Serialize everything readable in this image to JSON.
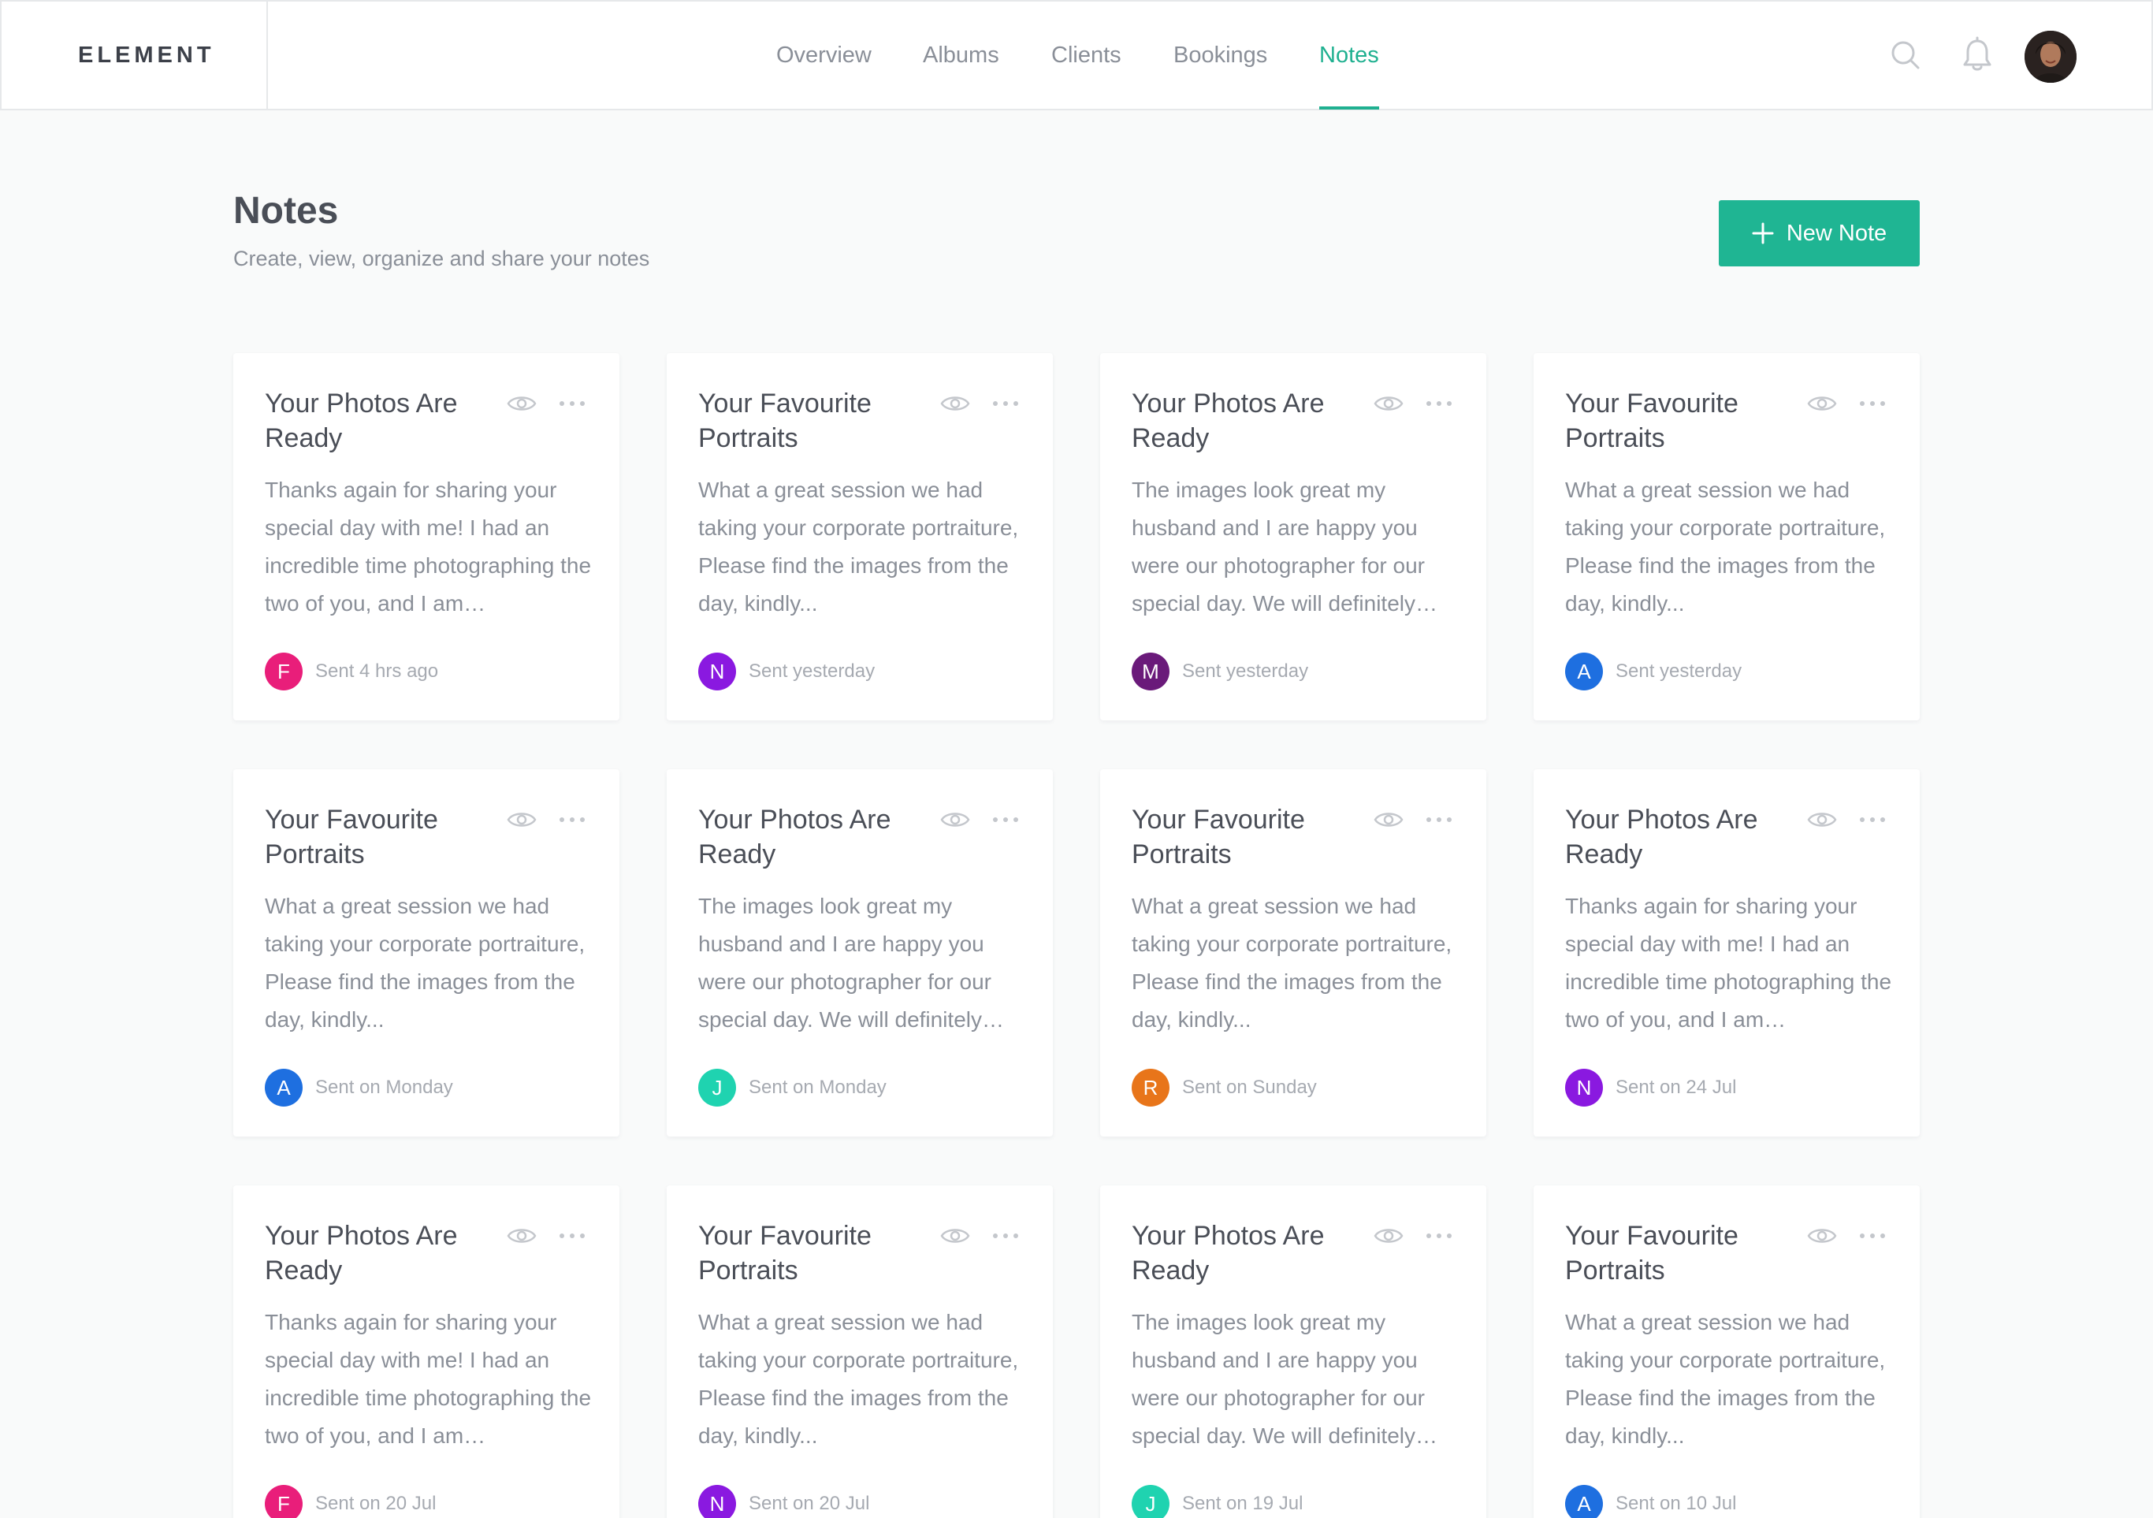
{
  "app": {
    "logo": "ELEMENT"
  },
  "nav": {
    "items": [
      {
        "label": "Overview",
        "active": false
      },
      {
        "label": "Albums",
        "active": false
      },
      {
        "label": "Clients",
        "active": false
      },
      {
        "label": "Bookings",
        "active": false
      },
      {
        "label": "Notes",
        "active": true
      }
    ]
  },
  "header_icons": [
    "search-icon",
    "bell-icon",
    "user-avatar"
  ],
  "page": {
    "title": "Notes",
    "subtitle": "Create, view, organize and share your notes",
    "new_note_label": "New Note"
  },
  "colors": {
    "accent": "#1fb593",
    "nav_active": "#1fb090"
  },
  "notes": [
    {
      "title": "Your Photos Are Ready",
      "body": "Thanks again for sharing your special day with me! I had an incredible time photographing the two of you, and I am…",
      "initial": "F",
      "color": "#e91e7a",
      "sent": "Sent 4 hrs ago"
    },
    {
      "title": "Your Favourite Portraits",
      "body": "What  a great session we had taking your corporate portraiture, Please find the images from the day, kindly...",
      "initial": "N",
      "color": "#8a19e0",
      "sent": "Sent yesterday"
    },
    {
      "title": "Your Photos Are Ready",
      "body": "The images look great my husband and I are happy you were our photographer for our special day. We will definitely…",
      "initial": "M",
      "color": "#6a1a7a",
      "sent": "Sent yesterday"
    },
    {
      "title": "Your Favourite Portraits",
      "body": "What  a great session we had taking your corporate portraiture, Please find the images from the day, kindly...",
      "initial": "A",
      "color": "#1e6fe0",
      "sent": "Sent yesterday"
    },
    {
      "title": "Your Favourite Portraits",
      "body": "What  a great session we had taking your corporate portraiture, Please find the images from the day, kindly...",
      "initial": "A",
      "color": "#1e6fe0",
      "sent": "Sent on Monday"
    },
    {
      "title": "Your Photos Are Ready",
      "body": "The images look great my husband and I are happy you were our photographer for our special day. We will definitely…",
      "initial": "J",
      "color": "#1fd3b0",
      "sent": "Sent on Monday"
    },
    {
      "title": "Your Favourite Portraits",
      "body": "What  a great session we had taking your corporate portraiture, Please find the images from the day, kindly...",
      "initial": "R",
      "color": "#e8751a",
      "sent": "Sent on Sunday"
    },
    {
      "title": "Your Photos Are Ready",
      "body": "Thanks again for sharing your special day with me! I had an incredible time photographing the two of you, and I am…",
      "initial": "N",
      "color": "#8a19e0",
      "sent": "Sent on 24 Jul"
    },
    {
      "title": "Your Photos Are Ready",
      "body": "Thanks again for sharing your special day with me! I had an incredible time photographing the two of you, and I am…",
      "initial": "F",
      "color": "#e91e7a",
      "sent": "Sent on 20 Jul"
    },
    {
      "title": "Your Favourite Portraits",
      "body": "What  a great session we had taking your corporate portraiture, Please find the images from the day, kindly...",
      "initial": "N",
      "color": "#8a19e0",
      "sent": "Sent on 20 Jul"
    },
    {
      "title": "Your Photos Are Ready",
      "body": "The images look great my husband and I are happy you were our photographer for our special day. We will definitely…",
      "initial": "J",
      "color": "#1fd3b0",
      "sent": "Sent on 19 Jul"
    },
    {
      "title": "Your Favourite Portraits",
      "body": "What  a great session we had taking your corporate portraiture, Please find the images from the day, kindly...",
      "initial": "A",
      "color": "#1e6fe0",
      "sent": "Sent on 10 Jul"
    }
  ]
}
